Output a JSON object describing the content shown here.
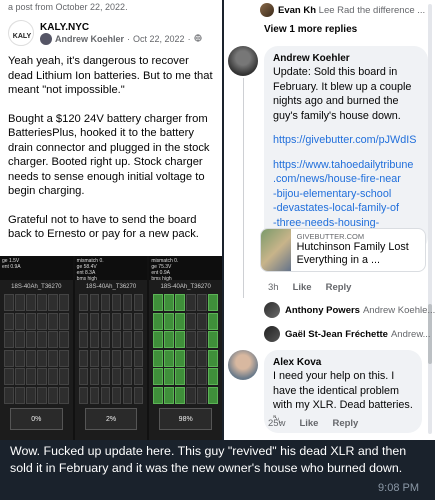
{
  "left_post": {
    "top_cut": "a post from October 22, 2022.",
    "page_name": "KALY.NYC",
    "author": "Andrew Koehler",
    "date": "Oct 22, 2022",
    "privacy": "·",
    "paragraphs": [
      "Yeah yeah, it's dangerous to recover dead Lithium Ion batteries. But to me that meant \"not impossible.\"",
      "Bought a $120 24V battery charger from BatteriesPlus, hooked it to the battery drain connector and plugged in the stock charger. Booted right up. Stock charger needs to sense enough initial voltage to begin charging.",
      "Grateful not to have to send the board back to Ernesto or pay for a new pack."
    ],
    "phones": [
      {
        "top": "ge 1.5V\nent 0.9A",
        "id": "18S-40Ah_T36270",
        "pct": "0%",
        "green_cells": 0
      },
      {
        "top": "mismatch 0.\nge 58.4V\nent 8.3A\nbms high",
        "id": "18S-40Ah_T36270",
        "pct": "2%",
        "green_cells": 0
      },
      {
        "top": "mismatch 0.\nge 75.3V\nent 0.9A\nbms high",
        "id": "18S-40Ah_T36270",
        "pct": "98%",
        "green_cells": 18
      }
    ]
  },
  "right_comments": {
    "top_reply": {
      "name": "Evan Kh",
      "text": "Lee Rad the difference ..."
    },
    "view_more": "View 1 more replies",
    "andrew": {
      "name": "Andrew Koehler",
      "text": "Update: Sold this board in February. It blew up a couple nights ago and burned the guy's family's house down.",
      "link1": "https://givebutter.com/pJWdIS",
      "link2": "https://www.tahoedailytribune.com/news/house-fire-near-bijou-elementary-school-devastates-local-family-of-three-needs-housing-clothing/",
      "link2_lines": [
        "https://www.tahoedailytribune",
        ".com/news/house-fire-near",
        "-bijou-elementary-school",
        "-devastates-local-family-of",
        "-three-needs-housing-clothing/"
      ],
      "preview_source": "GIVEBUTTER.COM",
      "preview_title": "Hutchinson Family Lost Everything in a ...",
      "time": "3h",
      "like": "Like",
      "reply": "Reply"
    },
    "replies": [
      {
        "name": "Anthony Powers",
        "text": "Andrew Koehle..."
      },
      {
        "name": "Gaël St-Jean Fréchette",
        "text": "Andrew..."
      }
    ],
    "alex": {
      "name": "Alex Kova",
      "text": "I need your help on this. I have the identical problem with my XLR. Dead batteries. ␀",
      "time": "25w",
      "like": "Like",
      "reply": "Reply"
    }
  },
  "caption": {
    "text": "Wow. Fucked up update here. This guy \"revived\" his dead XLR and then sold it in February and it was the new owner's house who burned down.",
    "time": "9:08 PM"
  },
  "colors": {
    "link": "#216fdb",
    "bubble": "#f0f2f5",
    "chat_bg": "#1a222c",
    "cell_green": "#3f8f3a"
  }
}
